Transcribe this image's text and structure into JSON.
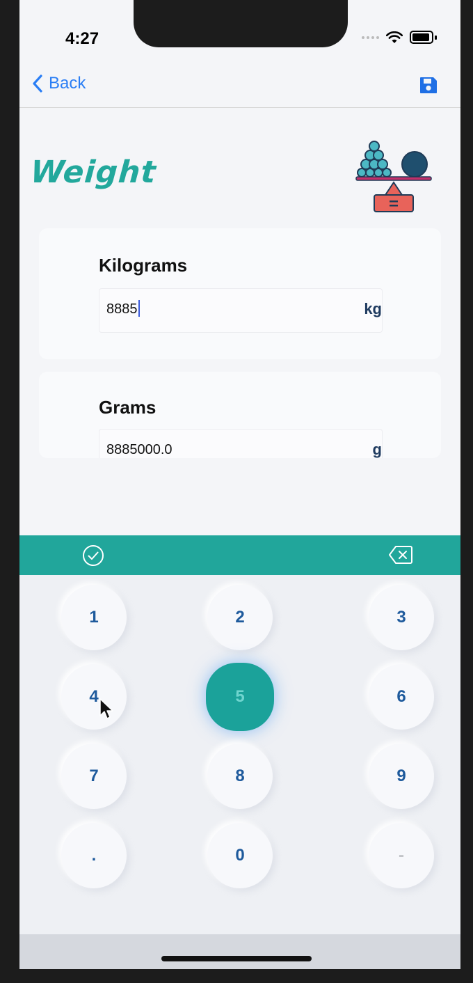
{
  "status": {
    "time": "4:27"
  },
  "nav": {
    "back_label": "Back"
  },
  "page": {
    "title": "Weight"
  },
  "fields": [
    {
      "label": "Kilograms",
      "value": "8885",
      "unit": "kg"
    },
    {
      "label": "Grams",
      "value": "8885000.0",
      "unit": "g"
    }
  ],
  "keypad": {
    "keys": [
      "1",
      "2",
      "3",
      "4",
      "5",
      "6",
      "7",
      "8",
      "9",
      ".",
      "0",
      "-"
    ],
    "pressed_key": "5"
  },
  "colors": {
    "accent": "#21a69b",
    "link": "#2a7ef5",
    "key_text": "#1e5a9c"
  }
}
